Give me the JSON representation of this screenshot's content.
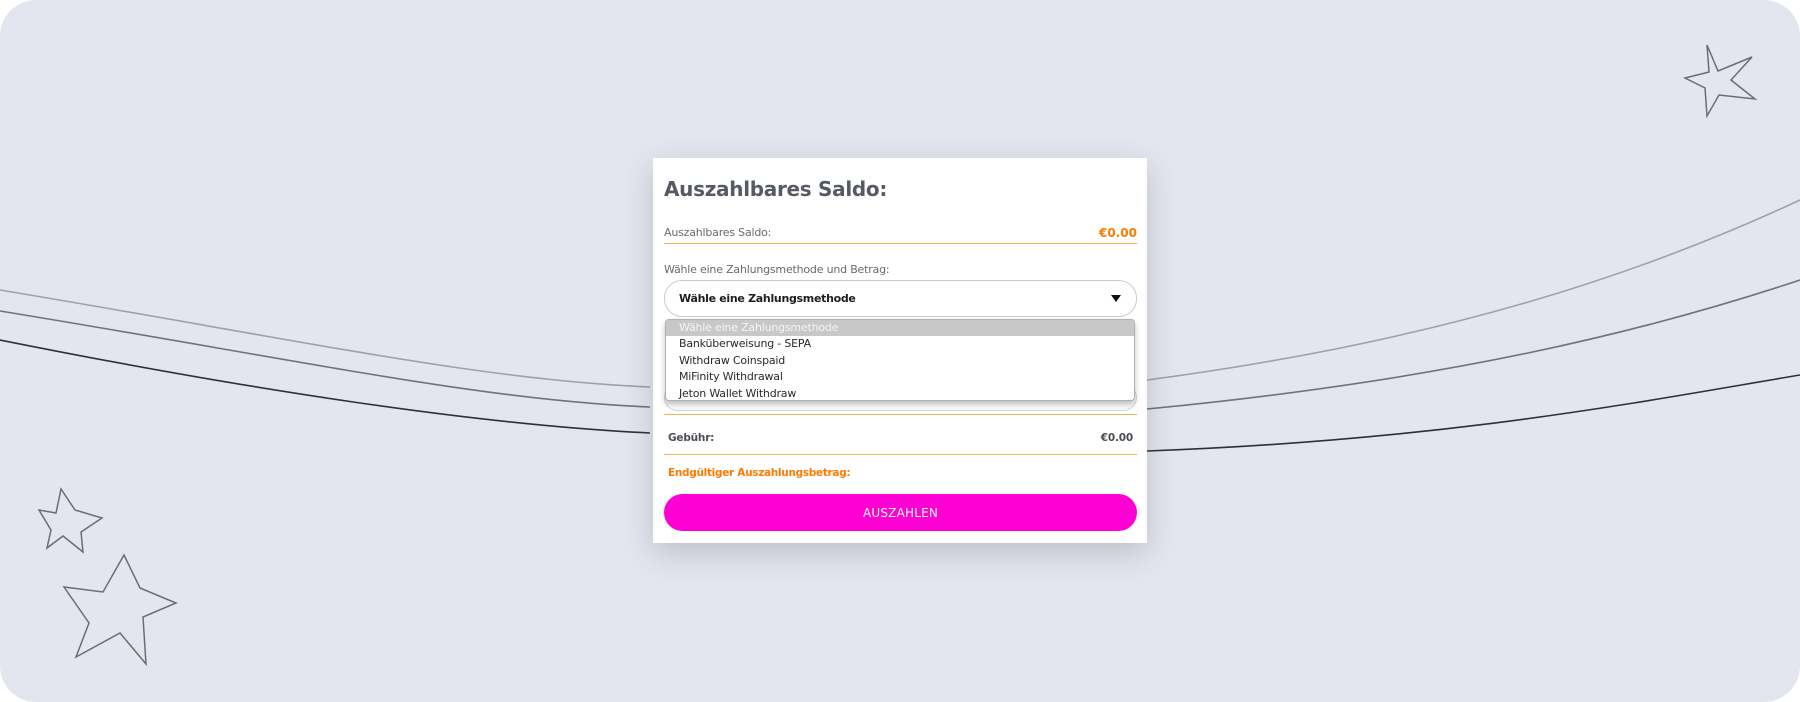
{
  "card": {
    "title": "Auszahlbares Saldo:",
    "balance_label": "Auszahlbares Saldo:",
    "balance_value": "€0.00",
    "method_label": "Wähle eine Zahlungsmethode und Betrag:",
    "select_value": "Wähle eine Zahlungsmethode",
    "options": [
      "Wähle eine Zahlungsmethode",
      "Banküberweisung - SEPA",
      "Withdraw Coinspaid",
      "MiFinity Withdrawal",
      "Jeton Wallet Withdraw"
    ],
    "fee_label": "Gebühr:",
    "fee_value": "€0.00",
    "final_label": "Endgültiger Auszahlungsbetrag:",
    "submit_label": "AUSZAHLEN"
  },
  "colors": {
    "background": "#e3e6ee",
    "accent_orange": "#ff7a00",
    "divider": "#f4b451",
    "button": "#ff00d4"
  },
  "icons": [
    "star-outline-icon",
    "caret-down-icon"
  ]
}
